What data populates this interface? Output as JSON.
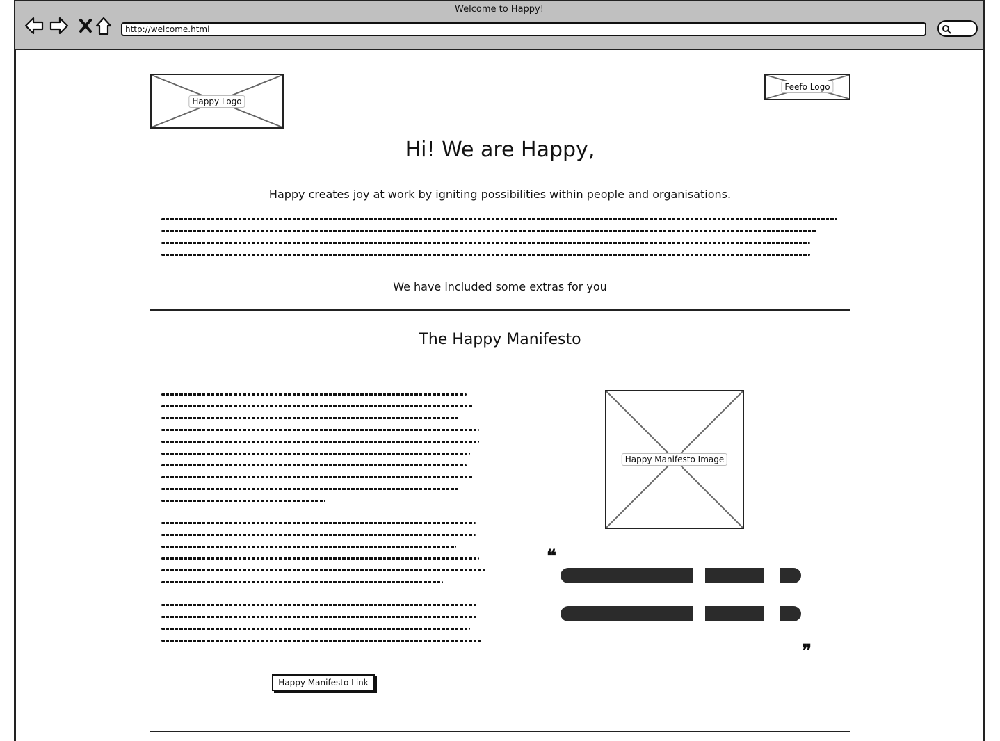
{
  "browser": {
    "title": "Welcome to Happy!",
    "url": "http://welcome.html",
    "icons": [
      "back-arrow-icon",
      "forward-arrow-icon",
      "close-icon",
      "home-icon",
      "search-icon"
    ]
  },
  "header": {
    "logo_label": "Happy Logo",
    "partner_logo_label": "Feefo Logo"
  },
  "intro": {
    "heading": "Hi! We are Happy,",
    "tagline": "Happy creates joy at work by igniting possibilities within people and organisations.",
    "extras_text": "We have included some extras for you"
  },
  "manifesto": {
    "heading": "The Happy Manifesto",
    "image_label": "Happy Manifesto Image",
    "link_label": "Happy Manifesto Link",
    "open_quote": "❝",
    "close_quote": "❞"
  }
}
